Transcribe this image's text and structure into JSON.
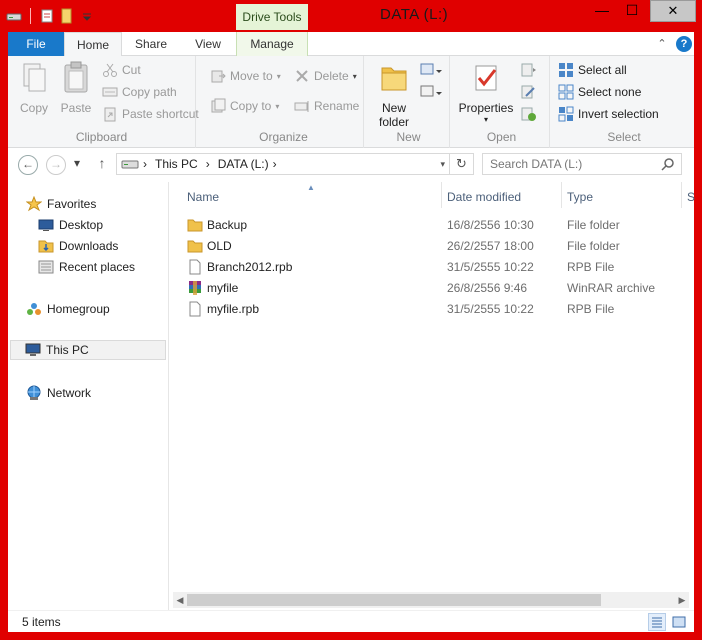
{
  "window": {
    "title": "DATA  (L:)",
    "contextual_tab": "Drive Tools",
    "minimize": "—",
    "maximize": "☐",
    "close": "✕"
  },
  "ribbon_tabs": [
    {
      "label": "File"
    },
    {
      "label": "Home"
    },
    {
      "label": "Share"
    },
    {
      "label": "View"
    },
    {
      "label": "Manage"
    }
  ],
  "ribbon": {
    "clipboard": {
      "label": "Clipboard",
      "copy": "Copy",
      "paste": "Paste",
      "cut": "Cut",
      "copy_path": "Copy path",
      "paste_shortcut": "Paste shortcut"
    },
    "organize": {
      "label": "Organize",
      "move_to": "Move to",
      "copy_to": "Copy to",
      "delete": "Delete",
      "rename": "Rename"
    },
    "new": {
      "label": "New",
      "new_folder": "New",
      "new_folder_line2": "folder"
    },
    "open": {
      "label": "Open",
      "properties": "Properties"
    },
    "select": {
      "label": "Select",
      "select_all": "Select all",
      "select_none": "Select none",
      "invert": "Invert selection"
    }
  },
  "nav": {
    "back": "←",
    "forward": "→",
    "up": "↑",
    "address": [
      "This PC",
      "DATA  (L:)"
    ],
    "search_placeholder": "Search DATA  (L:)"
  },
  "sidebar": {
    "favorites": "Favorites",
    "desktop": "Desktop",
    "downloads": "Downloads",
    "recent": "Recent places",
    "homegroup": "Homegroup",
    "this_pc": "This PC",
    "network": "Network"
  },
  "columns": {
    "name": "Name",
    "date": "Date modified",
    "type": "Type",
    "size": "Si"
  },
  "files": [
    {
      "name": "Backup",
      "date": "16/8/2556 10:30",
      "type": "File folder",
      "icon": "folder-icon"
    },
    {
      "name": "OLD",
      "date": "26/2/2557 18:00",
      "type": "File folder",
      "icon": "folder-icon"
    },
    {
      "name": "Branch2012.rpb",
      "date": "31/5/2555 10:22",
      "type": "RPB File",
      "icon": "file-icon"
    },
    {
      "name": "myfile",
      "date": "26/8/2556 9:46",
      "type": "WinRAR archive",
      "icon": "winrar-icon"
    },
    {
      "name": "myfile.rpb",
      "date": "31/5/2555 10:22",
      "type": "RPB File",
      "icon": "file-icon"
    }
  ],
  "status": {
    "count": "5 items"
  },
  "colors": {
    "frame": "#e00000",
    "file_tab": "#1979ca",
    "drive_tools": "#e5f4d7"
  }
}
